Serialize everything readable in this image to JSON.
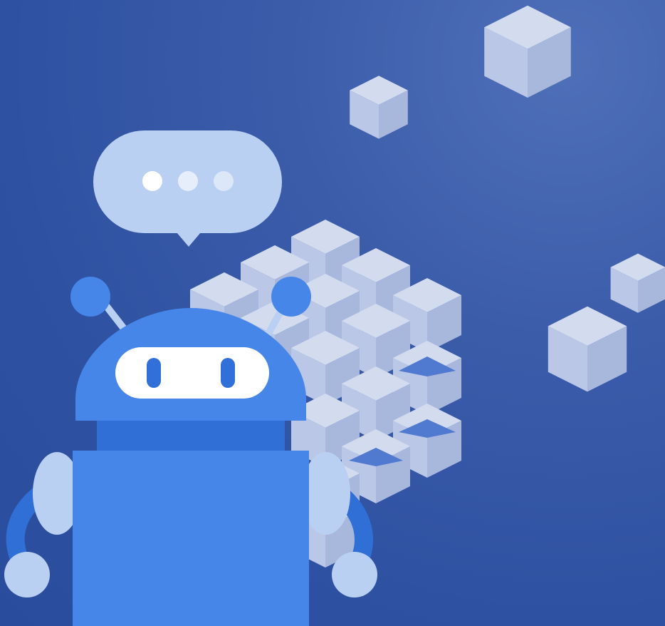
{
  "colors": {
    "background": "#2e51a1",
    "cube_top": "#ccd7ee",
    "cube_left": "#b7c5e6",
    "cube_right": "#a5b5dc",
    "robot_body": "#4586e8",
    "robot_dark": "#2f6fd6",
    "robot_light": "#bad0f2",
    "bubble": "#b9cff3",
    "eyes_visor": "#ffffff",
    "pupil": "#3170d9"
  },
  "icons": {
    "robot": "robot-icon",
    "speech_bubble": "speech-bubble-icon",
    "cubes": "isometric-cube-icon"
  }
}
